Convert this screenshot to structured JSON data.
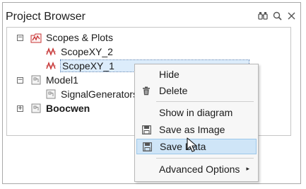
{
  "panel": {
    "title": "Project Browser"
  },
  "header_icons": [
    "binoculars-icon",
    "search-icon",
    "close-icon"
  ],
  "tree": [
    {
      "label": "Scopes & Plots",
      "expander": "−",
      "icon": "scopes-folder-icon"
    },
    {
      "label": "ScopeXY_2",
      "icon": "scope-icon"
    },
    {
      "label": "ScopeXY_1",
      "icon": "scope-icon",
      "selected": true
    },
    {
      "label": "Model1",
      "expander": "−",
      "icon": "model-icon"
    },
    {
      "label": "SignalGenerators",
      "icon": "model-icon"
    },
    {
      "label": "Boocwen",
      "expander": "+",
      "icon": "model-icon",
      "bold": true
    }
  ],
  "context_menu": {
    "items": [
      {
        "label": "Hide"
      },
      {
        "label": "Delete",
        "icon": "trash-icon"
      },
      {
        "label": "Show in diagram"
      },
      {
        "label": "Save as Image",
        "icon": "save-icon"
      },
      {
        "label": "Save Data",
        "icon": "save-icon",
        "hover": true
      },
      {
        "label": "Advanced Options",
        "submenu_arrow": "▸"
      }
    ]
  }
}
